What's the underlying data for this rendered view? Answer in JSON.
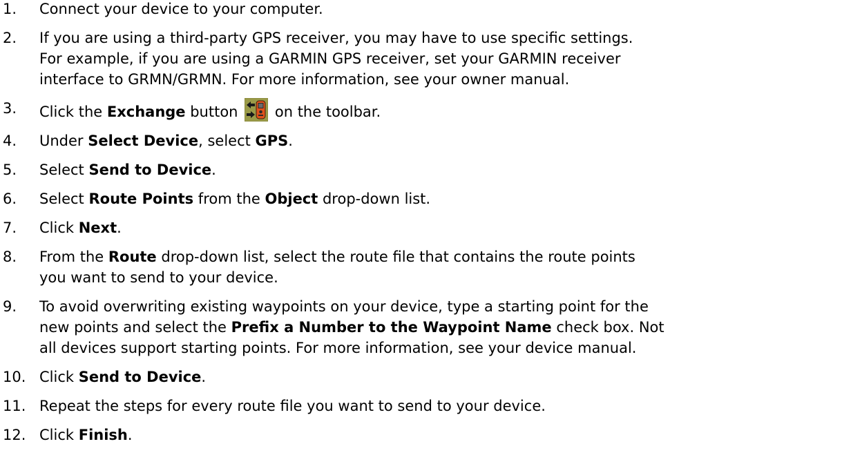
{
  "steps": [
    {
      "number": "1.",
      "lines": [
        [
          "Connect your device to your computer."
        ]
      ]
    },
    {
      "number": "2.",
      "lines": [
        [
          "If you are using a third-party GPS receiver, you may have to use specific settings."
        ],
        [
          "For example, if you are using a GARMIN GPS receiver, set your GARMIN receiver"
        ],
        [
          "interface to GRMN/GRMN. For more information, see your owner manual."
        ]
      ]
    },
    {
      "number": "3.",
      "parts": {
        "pre": "Click the ",
        "bold": "Exchange",
        "mid": " button",
        "post": " on the toolbar."
      },
      "icon": "exchange-device-icon"
    },
    {
      "number": "4.",
      "lines": [
        [
          {
            "t": "Under "
          },
          {
            "b": "Select Device"
          },
          {
            "t": ", select "
          },
          {
            "b": "GPS"
          },
          {
            "t": "."
          }
        ]
      ]
    },
    {
      "number": "5.",
      "lines": [
        [
          {
            "t": "Select "
          },
          {
            "b": "Send to Device"
          },
          {
            "t": "."
          }
        ]
      ]
    },
    {
      "number": "6.",
      "lines": [
        [
          {
            "t": "Select "
          },
          {
            "b": "Route Points"
          },
          {
            "t": " from the "
          },
          {
            "b": "Object"
          },
          {
            "t": " drop-down list."
          }
        ]
      ]
    },
    {
      "number": "7.",
      "lines": [
        [
          {
            "t": "Click "
          },
          {
            "b": "Next"
          },
          {
            "t": "."
          }
        ]
      ]
    },
    {
      "number": "8.",
      "lines": [
        [
          {
            "t": "From the "
          },
          {
            "b": "Route"
          },
          {
            "t": " drop-down list, select the route file that contains the route points"
          }
        ],
        [
          {
            "t": "you want to send to your device."
          }
        ]
      ]
    },
    {
      "number": "9.",
      "lines": [
        [
          {
            "t": "To avoid overwriting existing waypoints on your device, type a starting point for the"
          }
        ],
        [
          {
            "t": "new points and select the "
          },
          {
            "b": "Prefix a Number to the Waypoint Name"
          },
          {
            "t": " check box. Not"
          }
        ],
        [
          {
            "t": "all devices support starting points. For more information, see your device manual."
          }
        ]
      ]
    },
    {
      "number": "10.",
      "lines": [
        [
          {
            "t": "Click "
          },
          {
            "b": "Send to Device"
          },
          {
            "t": "."
          }
        ]
      ]
    },
    {
      "number": "11.",
      "lines": [
        [
          {
            "t": "Repeat the steps for every route file you want to send to your device."
          }
        ]
      ]
    },
    {
      "number": "12.",
      "lines": [
        [
          {
            "t": "Click "
          },
          {
            "b": "Finish"
          },
          {
            "t": "."
          }
        ]
      ]
    }
  ],
  "colors": {
    "text": "#000000",
    "icon_bg": "#8c8c3c",
    "icon_device": "#e0521c"
  }
}
